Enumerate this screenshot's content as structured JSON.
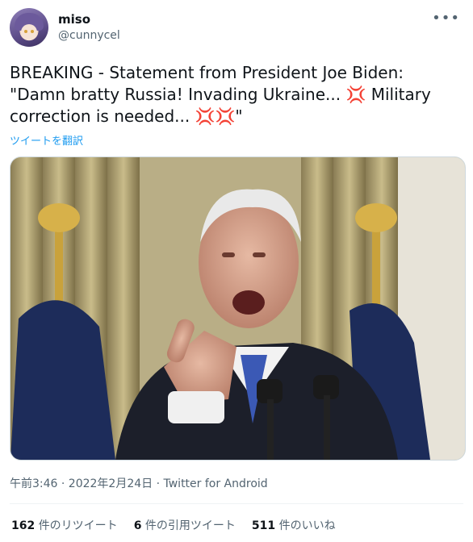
{
  "user": {
    "display_name": "miso",
    "handle": "@cunnycel"
  },
  "tweet": {
    "text_line1": "BREAKING - Statement from President Joe Biden:",
    "text_line2": "\"Damn bratty Russia! Invading Ukraine... ",
    "text_line2_tail": " Military",
    "text_line3": "correction is needed... ",
    "text_line3_tail": "\"",
    "anger_symbol": "💢",
    "translate_label": "ツイートを翻訳"
  },
  "meta": {
    "timestamp": "午前3:46 · 2022年2月24日 · Twitter for Android"
  },
  "stats": [
    {
      "count": "162",
      "label": "件のリツイート"
    },
    {
      "count": "6",
      "label": "件の引用ツイート"
    },
    {
      "count": "511",
      "label": "件のいいね"
    }
  ]
}
